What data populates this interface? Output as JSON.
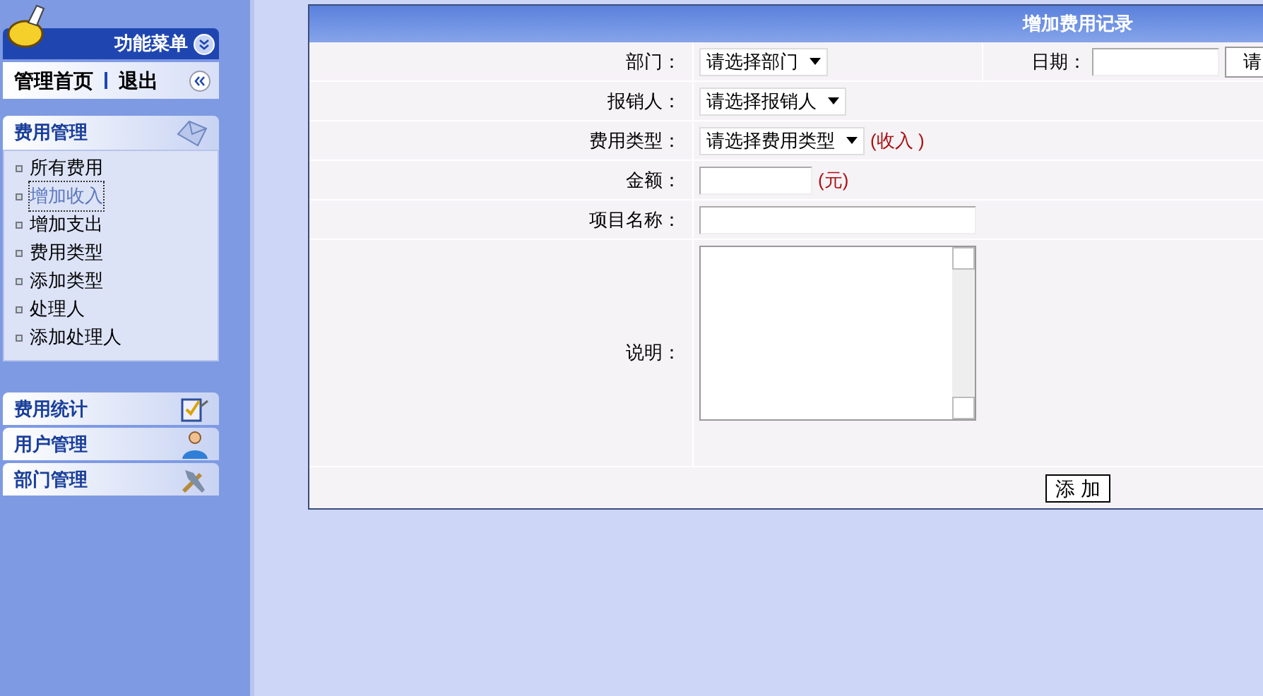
{
  "sidebar": {
    "menu_title": "功能菜单",
    "nav_links": [
      "管理首页",
      "退出"
    ],
    "sections": [
      {
        "title": "费用管理",
        "expanded": true,
        "items": [
          {
            "label": "所有费用",
            "selected": false
          },
          {
            "label": "增加收入",
            "selected": true
          },
          {
            "label": "增加支出",
            "selected": false
          },
          {
            "label": "费用类型",
            "selected": false
          },
          {
            "label": "添加类型",
            "selected": false
          },
          {
            "label": "处理人",
            "selected": false
          },
          {
            "label": "添加处理人",
            "selected": false
          }
        ]
      },
      {
        "title": "费用统计",
        "expanded": false
      },
      {
        "title": "用户管理",
        "expanded": false
      },
      {
        "title": "部门管理",
        "expanded": false
      }
    ]
  },
  "form": {
    "title": "增加费用记录",
    "rows": [
      {
        "label": "部门：",
        "kind": "select",
        "value": "请选择部门",
        "extra": {
          "label": "日期：",
          "button": "请"
        }
      },
      {
        "label": "报销人：",
        "kind": "select",
        "value": "请选择报销人"
      },
      {
        "label": "费用类型：",
        "kind": "select",
        "value": "请选择费用类型",
        "suffix": "(收入 )"
      },
      {
        "label": "金额：",
        "kind": "text",
        "suffix": "(元)"
      },
      {
        "label": "项目名称：",
        "kind": "wide"
      },
      {
        "label": "说明：",
        "kind": "textarea"
      }
    ],
    "submit": "添 加"
  }
}
